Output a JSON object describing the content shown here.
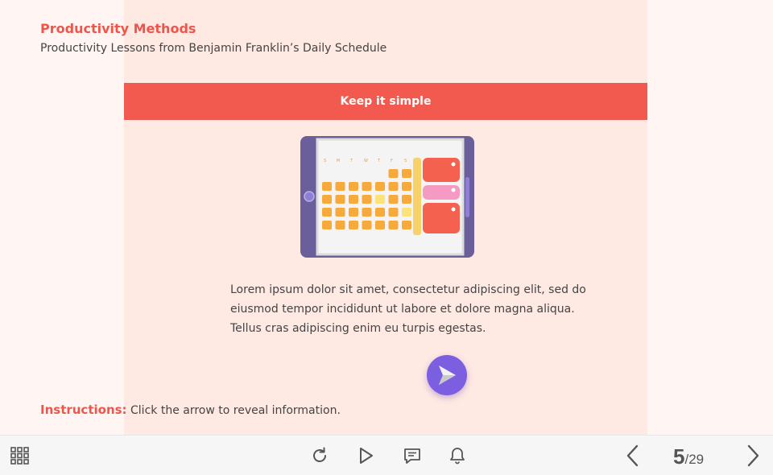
{
  "header": {
    "title": "Productivity Methods",
    "subtitle": "Productivity Lessons from Benjamin Franklin’s Daily Schedule"
  },
  "banner": {
    "label": "Keep it simple"
  },
  "content": {
    "body": "Lorem ipsum dolor sit amet, consectetur adipiscing elit, sed do eiusmod tempor incididunt ut labore et dolore magna aliqua. Tellus cras adipiscing enim eu turpis egestas."
  },
  "illustration": {
    "icon": "tablet-calendar-icon",
    "weekday_letters": [
      "S",
      "M",
      "T",
      "W",
      "T",
      "F",
      "S"
    ]
  },
  "instructions": {
    "label": "Instructions:",
    "text": "Click the arrow to reveal information."
  },
  "toolbar": {
    "menu_icon": "grid-menu-icon",
    "replay_icon": "replay-icon",
    "play_icon": "play-icon",
    "transcript_icon": "transcript-icon",
    "notification_icon": "bell-icon",
    "prev_icon": "chevron-left-icon",
    "next_icon": "chevron-right-icon",
    "current_page": "5",
    "total_pages": "/29"
  },
  "colors": {
    "accent": "#f35a4f",
    "title": "#f0554a",
    "panel": "#ffe9e3",
    "background": "#fff5f3",
    "arrow_button": "#7b5fe0"
  }
}
